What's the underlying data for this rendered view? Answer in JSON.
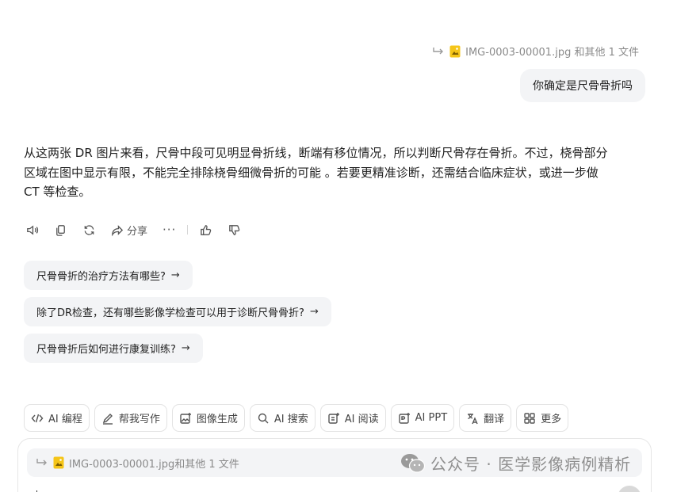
{
  "attachment_ref": {
    "text": "IMG-0003-00001.jpg 和其他 1 文件"
  },
  "user_message": "你确定是尺骨骨折吗",
  "answer": {
    "line1": "从这两张 DR 图片来看，尺骨中段可见明显骨折线，断端有移位情况，所以判断尺骨存在骨折。不过，桡骨部分",
    "line2": "区域在图中显示有限，不能完全排除桡骨细微骨折的可能 。若要更精准诊断，还需结合临床症状，或进一步做",
    "line3": "CT 等检查。"
  },
  "actions": {
    "share_label": "分享",
    "more_label": "···",
    "icons": [
      "speaker-icon",
      "copy-icon",
      "refresh-icon",
      "share-icon",
      "more-icon",
      "thumbs-up-icon",
      "thumbs-down-icon"
    ]
  },
  "suggestions": [
    {
      "text": "尺骨骨折的治疗方法有哪些?",
      "arrow": "→"
    },
    {
      "text": "除了DR检查，还有哪些影像学检查可以用于诊断尺骨骨折?",
      "arrow": "→"
    },
    {
      "text": "尺骨骨折后如何进行康复训练?",
      "arrow": "→"
    }
  ],
  "tools": [
    {
      "label": "AI 编程",
      "icon": "code-icon"
    },
    {
      "label": "帮我写作",
      "icon": "pen-icon"
    },
    {
      "label": "图像生成",
      "icon": "image-gen-icon"
    },
    {
      "label": "AI 搜索",
      "icon": "search-icon"
    },
    {
      "label": "AI 阅读",
      "icon": "reader-icon"
    },
    {
      "label": "AI PPT",
      "icon": "ppt-icon"
    },
    {
      "label": "翻译",
      "icon": "translate-icon"
    },
    {
      "label": "更多",
      "icon": "grid-icon"
    }
  ],
  "composer": {
    "attachment_text": "IMG-0003-00001.jpg和其他 1 文件"
  },
  "watermark": {
    "text": "公众号 · 医学影像病例精析"
  },
  "colors": {
    "bubble_bg": "#f3f4f6",
    "text": "#1f1f1f",
    "muted": "#8a8a8a",
    "thumb_yellow": "#f5c518"
  }
}
